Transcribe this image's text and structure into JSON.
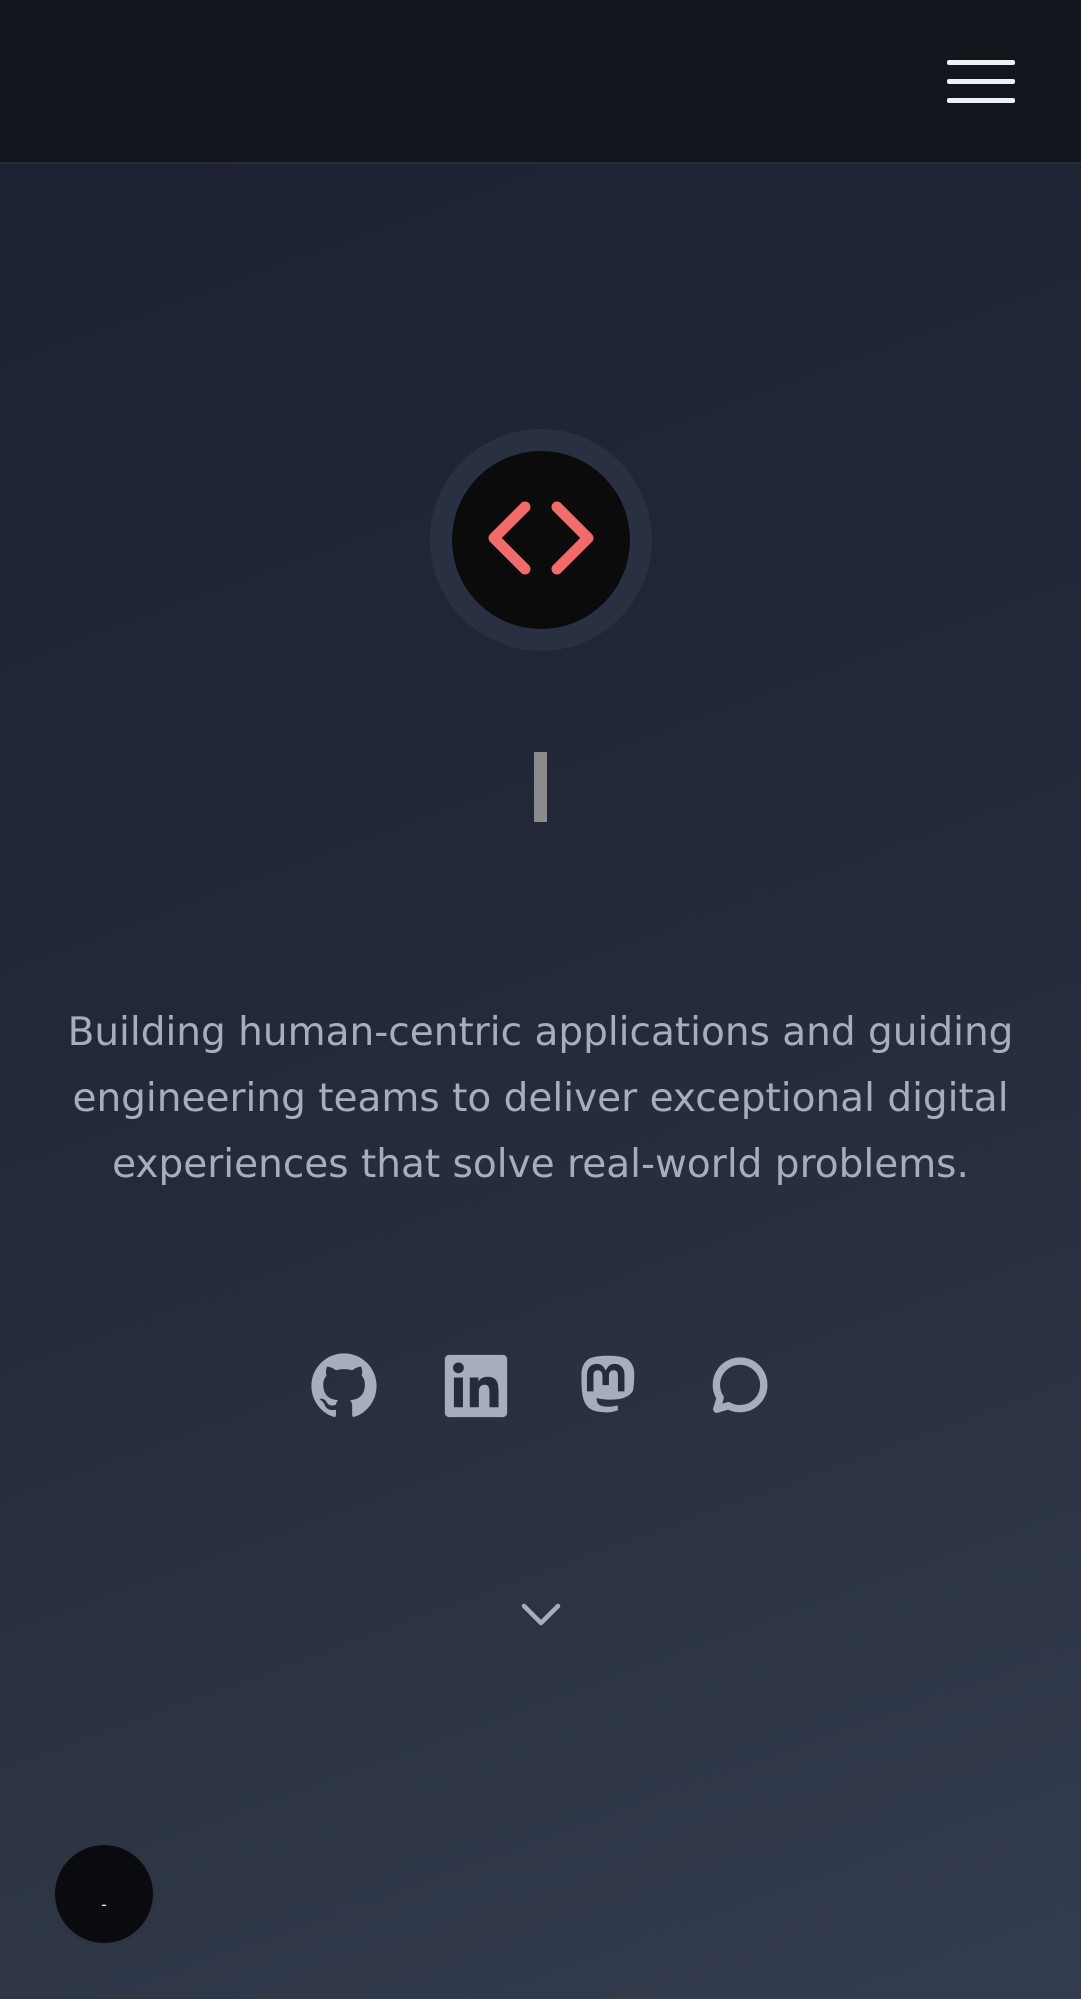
{
  "header": {
    "menu_icon": "hamburger-menu-icon"
  },
  "hero": {
    "logo_icon": "code-brackets-icon",
    "accent_color": "#f26b6b",
    "tagline": "Building human-centric applications and guiding engineering teams to deliver exceptional digital experiences that solve real-world problems."
  },
  "socials": [
    {
      "icon": "github-icon"
    },
    {
      "icon": "linkedin-icon"
    },
    {
      "icon": "mastodon-icon"
    },
    {
      "icon": "chat-bubble-icon"
    }
  ],
  "scroll_icon": "chevron-down-icon",
  "theme_toggle": {
    "label": "-"
  }
}
